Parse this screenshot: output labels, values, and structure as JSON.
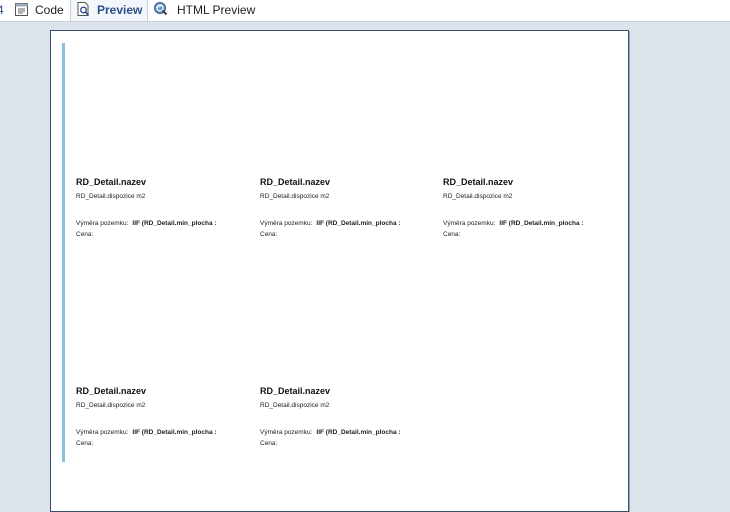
{
  "tabs": [
    {
      "label": "Code",
      "icon": "code-file-icon"
    },
    {
      "label": "Preview",
      "icon": "preview-icon",
      "active": true
    },
    {
      "label": "HTML Preview",
      "icon": "html-preview-icon"
    }
  ],
  "partial_left_glyph": "4",
  "report": {
    "cards": [
      {
        "title": "RD_Detail.nazev",
        "dispozice": "RD_Detail.dispozice m2",
        "vymera_label": "Výměra pozemku:",
        "vymera_expr": "IIF (RD_Detail.min_plocha :",
        "cena_label": "Cena:"
      },
      {
        "title": "RD_Detail.nazev",
        "dispozice": "RD_Detail.dispozice m2",
        "vymera_label": "Výměra pozemku:",
        "vymera_expr": "IIF (RD_Detail.min_plocha :",
        "cena_label": "Cena:"
      },
      {
        "title": "RD_Detail.nazev",
        "dispozice": "RD_Detail.dispozice m2",
        "vymera_label": "Výměra pozemku:",
        "vymera_expr": "IIF (RD_Detail.min_plocha :",
        "cena_label": "Cena:"
      },
      {
        "title": "RD_Detail.nazev",
        "dispozice": "RD_Detail.dispozice m2",
        "vymera_label": "Výměra pozemku:",
        "vymera_expr": "IIF (RD_Detail.min_plocha :",
        "cena_label": "Cena:"
      },
      {
        "title": "RD_Detail.nazev",
        "dispozice": "RD_Detail.dispozice m2",
        "vymera_label": "Výměra pozemku:",
        "vymera_expr": "IIF (RD_Detail.min_plocha :",
        "cena_label": "Cena:"
      }
    ]
  },
  "colors": {
    "canvas_bg": "#dde3ea",
    "page_border": "#3c4f6e",
    "left_rule": "#8ec0e0",
    "active_tab_text": "#2b4f8a"
  }
}
